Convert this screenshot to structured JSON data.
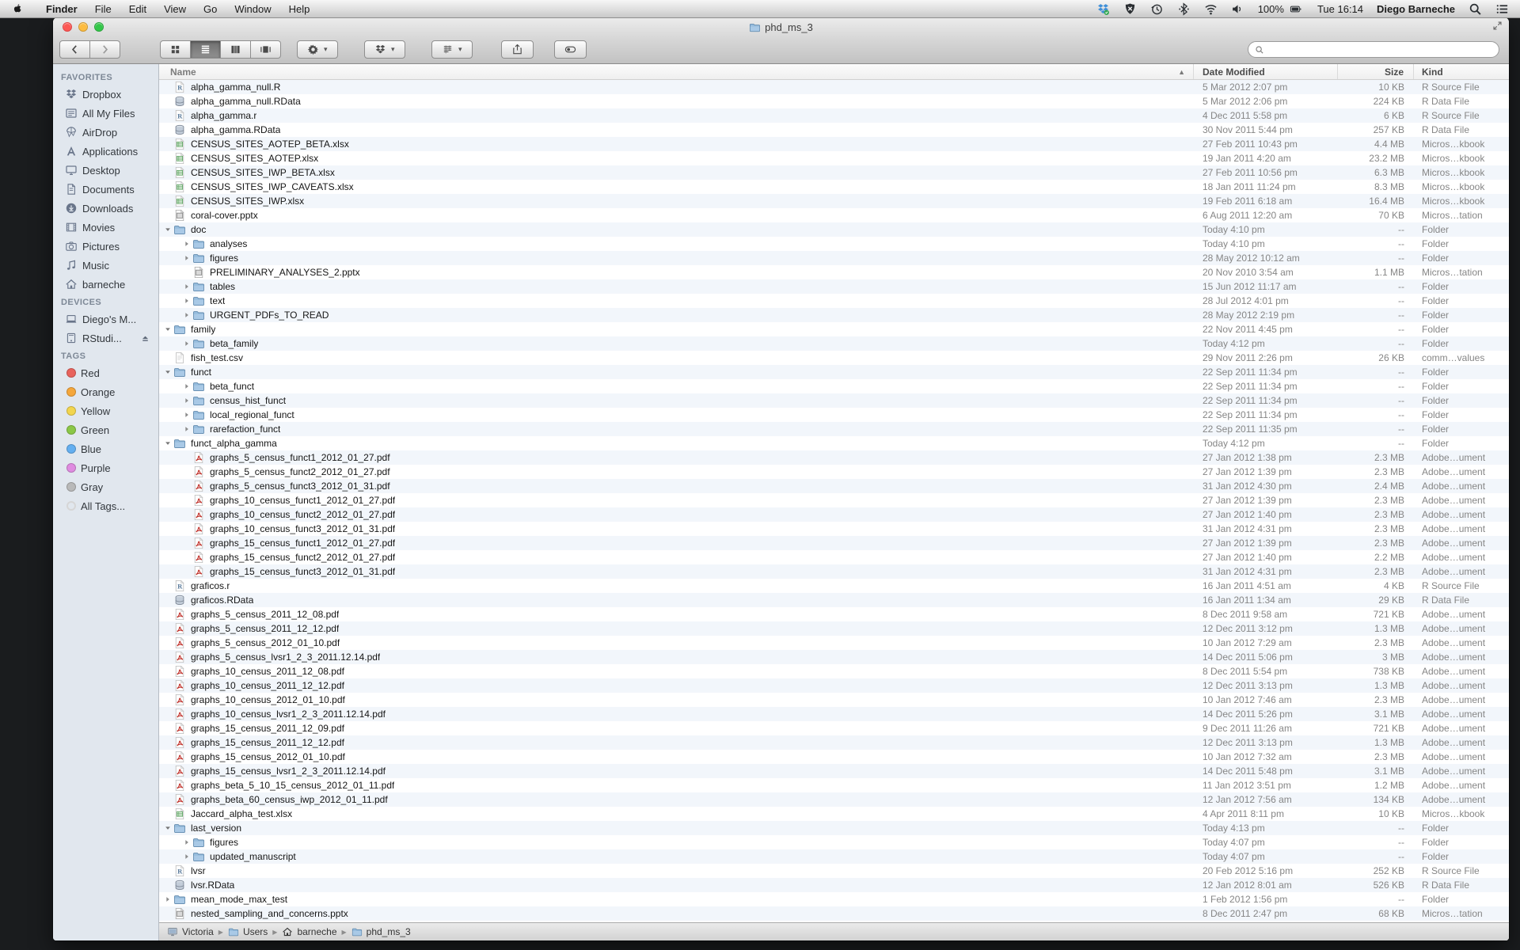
{
  "menu_bar": {
    "apple_icon": "apple",
    "items": [
      "Finder",
      "File",
      "Edit",
      "View",
      "Go",
      "Window",
      "Help"
    ],
    "active_app": "Finder",
    "status_icons": [
      "dropbox",
      "shield",
      "time-machine",
      "bluetooth",
      "wifi",
      "volume"
    ],
    "battery_percent": "100%",
    "clock": "Tue 16:14",
    "user": "Diego Barneche"
  },
  "window": {
    "title": "phd_ms_3",
    "title_icon": "folder",
    "traffic_lights": [
      "close",
      "minimize",
      "zoom"
    ]
  },
  "toolbar": {
    "nav": [
      "back",
      "forward"
    ],
    "view_modes": [
      "icons",
      "list",
      "columns",
      "coverflow"
    ],
    "selected_view": "list",
    "dropdowns": [
      "action-gear",
      "dropbox",
      "arrange"
    ],
    "buttons": [
      "share",
      "tags"
    ],
    "search": {
      "value": "",
      "placeholder": ""
    }
  },
  "sidebar": {
    "sections": [
      {
        "title": "FAVORITES",
        "items": [
          {
            "label": "Dropbox",
            "icon": "dropbox-side"
          },
          {
            "label": "All My Files",
            "icon": "all-my-files"
          },
          {
            "label": "AirDrop",
            "icon": "airdrop"
          },
          {
            "label": "Applications",
            "icon": "applications"
          },
          {
            "label": "Desktop",
            "icon": "desktop"
          },
          {
            "label": "Documents",
            "icon": "documents"
          },
          {
            "label": "Downloads",
            "icon": "downloads"
          },
          {
            "label": "Movies",
            "icon": "movies"
          },
          {
            "label": "Pictures",
            "icon": "pictures"
          },
          {
            "label": "Music",
            "icon": "music"
          },
          {
            "label": "barneche",
            "icon": "home"
          }
        ]
      },
      {
        "title": "DEVICES",
        "items": [
          {
            "label": "Diego's M...",
            "icon": "laptop"
          },
          {
            "label": "RStudi...",
            "icon": "drive",
            "eject": true
          }
        ]
      },
      {
        "title": "TAGS",
        "items": [
          {
            "label": "Red",
            "icon": "tag",
            "color": "#e8635c"
          },
          {
            "label": "Orange",
            "icon": "tag",
            "color": "#f5a73b"
          },
          {
            "label": "Yellow",
            "icon": "tag",
            "color": "#f2d54e"
          },
          {
            "label": "Green",
            "icon": "tag",
            "color": "#8bc747"
          },
          {
            "label": "Blue",
            "icon": "tag",
            "color": "#64aff0"
          },
          {
            "label": "Purple",
            "icon": "tag",
            "color": "#df8be0"
          },
          {
            "label": "Gray",
            "icon": "tag",
            "color": "#b9b9b9"
          },
          {
            "label": "All Tags...",
            "icon": "all-tags",
            "color": "#d6d6d6"
          }
        ]
      }
    ]
  },
  "list": {
    "columns": {
      "name": "Name",
      "date": "Date Modified",
      "size": "Size",
      "kind": "Kind"
    },
    "sort_column": "name",
    "sort_direction": "asc",
    "rows": [
      {
        "name": "alpha_gamma_null.R",
        "date": "5 Mar 2012 2:07 pm",
        "size": "10 KB",
        "kind": "R Source File",
        "icon": "r",
        "indent": 0,
        "disclosure": null
      },
      {
        "name": "alpha_gamma_null.RData",
        "date": "5 Mar 2012 2:06 pm",
        "size": "224 KB",
        "kind": "R Data File",
        "icon": "rdata",
        "indent": 0,
        "disclosure": null
      },
      {
        "name": "alpha_gamma.r",
        "date": "4 Dec 2011 5:58 pm",
        "size": "6 KB",
        "kind": "R Source File",
        "icon": "r",
        "indent": 0,
        "disclosure": null
      },
      {
        "name": "alpha_gamma.RData",
        "date": "30 Nov 2011 5:44 pm",
        "size": "257 KB",
        "kind": "R Data File",
        "icon": "rdata",
        "indent": 0,
        "disclosure": null
      },
      {
        "name": "CENSUS_SITES_AOTEP_BETA.xlsx",
        "date": "27 Feb 2011 10:43 pm",
        "size": "4.4 MB",
        "kind": "Micros…kbook",
        "icon": "xlsx",
        "indent": 0,
        "disclosure": null
      },
      {
        "name": "CENSUS_SITES_AOTEP.xlsx",
        "date": "19 Jan 2011 4:20 am",
        "size": "23.2 MB",
        "kind": "Micros…kbook",
        "icon": "xlsx",
        "indent": 0,
        "disclosure": null
      },
      {
        "name": "CENSUS_SITES_IWP_BETA.xlsx",
        "date": "27 Feb 2011 10:56 pm",
        "size": "6.3 MB",
        "kind": "Micros…kbook",
        "icon": "xlsx",
        "indent": 0,
        "disclosure": null
      },
      {
        "name": "CENSUS_SITES_IWP_CAVEATS.xlsx",
        "date": "18 Jan 2011 11:24 pm",
        "size": "8.3 MB",
        "kind": "Micros…kbook",
        "icon": "xlsx",
        "indent": 0,
        "disclosure": null
      },
      {
        "name": "CENSUS_SITES_IWP.xlsx",
        "date": "19 Feb 2011 6:18 am",
        "size": "16.4 MB",
        "kind": "Micros…kbook",
        "icon": "xlsx",
        "indent": 0,
        "disclosure": null
      },
      {
        "name": "coral-cover.pptx",
        "date": "6 Aug 2011 12:20 am",
        "size": "70 KB",
        "kind": "Micros…tation",
        "icon": "pptx",
        "indent": 0,
        "disclosure": null
      },
      {
        "name": "doc",
        "date": "Today 4:10 pm",
        "size": "--",
        "kind": "Folder",
        "icon": "folder",
        "indent": 0,
        "disclosure": "open"
      },
      {
        "name": "analyses",
        "date": "Today 4:10 pm",
        "size": "--",
        "kind": "Folder",
        "icon": "folder",
        "indent": 1,
        "disclosure": "closed"
      },
      {
        "name": "figures",
        "date": "28 May 2012 10:12 am",
        "size": "--",
        "kind": "Folder",
        "icon": "folder",
        "indent": 1,
        "disclosure": "closed"
      },
      {
        "name": "PRELIMINARY_ANALYSES_2.pptx",
        "date": "20 Nov 2010 3:54 am",
        "size": "1.1 MB",
        "kind": "Micros…tation",
        "icon": "pptx",
        "indent": 1,
        "disclosure": null
      },
      {
        "name": "tables",
        "date": "15 Jun 2012 11:17 am",
        "size": "--",
        "kind": "Folder",
        "icon": "folder",
        "indent": 1,
        "disclosure": "closed"
      },
      {
        "name": "text",
        "date": "28 Jul 2012 4:01 pm",
        "size": "--",
        "kind": "Folder",
        "icon": "folder",
        "indent": 1,
        "disclosure": "closed"
      },
      {
        "name": "URGENT_PDFs_TO_READ",
        "date": "28 May 2012 2:19 pm",
        "size": "--",
        "kind": "Folder",
        "icon": "folder",
        "indent": 1,
        "disclosure": "closed"
      },
      {
        "name": "family",
        "date": "22 Nov 2011 4:45 pm",
        "size": "--",
        "kind": "Folder",
        "icon": "folder",
        "indent": 0,
        "disclosure": "open"
      },
      {
        "name": "beta_family",
        "date": "Today 4:12 pm",
        "size": "--",
        "kind": "Folder",
        "icon": "folder",
        "indent": 1,
        "disclosure": "closed"
      },
      {
        "name": "fish_test.csv",
        "date": "29 Nov 2011 2:26 pm",
        "size": "26 KB",
        "kind": "comm…values",
        "icon": "csv",
        "indent": 0,
        "disclosure": null
      },
      {
        "name": "funct",
        "date": "22 Sep 2011 11:34 pm",
        "size": "--",
        "kind": "Folder",
        "icon": "folder",
        "indent": 0,
        "disclosure": "open"
      },
      {
        "name": "beta_funct",
        "date": "22 Sep 2011 11:34 pm",
        "size": "--",
        "kind": "Folder",
        "icon": "folder",
        "indent": 1,
        "disclosure": "closed"
      },
      {
        "name": "census_hist_funct",
        "date": "22 Sep 2011 11:34 pm",
        "size": "--",
        "kind": "Folder",
        "icon": "folder",
        "indent": 1,
        "disclosure": "closed"
      },
      {
        "name": "local_regional_funct",
        "date": "22 Sep 2011 11:34 pm",
        "size": "--",
        "kind": "Folder",
        "icon": "folder",
        "indent": 1,
        "disclosure": "closed"
      },
      {
        "name": "rarefaction_funct",
        "date": "22 Sep 2011 11:35 pm",
        "size": "--",
        "kind": "Folder",
        "icon": "folder",
        "indent": 1,
        "disclosure": "closed"
      },
      {
        "name": "funct_alpha_gamma",
        "date": "Today 4:12 pm",
        "size": "--",
        "kind": "Folder",
        "icon": "folder",
        "indent": 0,
        "disclosure": "open"
      },
      {
        "name": "graphs_5_census_funct1_2012_01_27.pdf",
        "date": "27 Jan 2012 1:38 pm",
        "size": "2.3 MB",
        "kind": "Adobe…ument",
        "icon": "pdf",
        "indent": 1,
        "disclosure": null
      },
      {
        "name": "graphs_5_census_funct2_2012_01_27.pdf",
        "date": "27 Jan 2012 1:39 pm",
        "size": "2.3 MB",
        "kind": "Adobe…ument",
        "icon": "pdf",
        "indent": 1,
        "disclosure": null
      },
      {
        "name": "graphs_5_census_funct3_2012_01_31.pdf",
        "date": "31 Jan 2012 4:30 pm",
        "size": "2.4 MB",
        "kind": "Adobe…ument",
        "icon": "pdf",
        "indent": 1,
        "disclosure": null
      },
      {
        "name": "graphs_10_census_funct1_2012_01_27.pdf",
        "date": "27 Jan 2012 1:39 pm",
        "size": "2.3 MB",
        "kind": "Adobe…ument",
        "icon": "pdf",
        "indent": 1,
        "disclosure": null
      },
      {
        "name": "graphs_10_census_funct2_2012_01_27.pdf",
        "date": "27 Jan 2012 1:40 pm",
        "size": "2.3 MB",
        "kind": "Adobe…ument",
        "icon": "pdf",
        "indent": 1,
        "disclosure": null
      },
      {
        "name": "graphs_10_census_funct3_2012_01_31.pdf",
        "date": "31 Jan 2012 4:31 pm",
        "size": "2.3 MB",
        "kind": "Adobe…ument",
        "icon": "pdf",
        "indent": 1,
        "disclosure": null
      },
      {
        "name": "graphs_15_census_funct1_2012_01_27.pdf",
        "date": "27 Jan 2012 1:39 pm",
        "size": "2.3 MB",
        "kind": "Adobe…ument",
        "icon": "pdf",
        "indent": 1,
        "disclosure": null
      },
      {
        "name": "graphs_15_census_funct2_2012_01_27.pdf",
        "date": "27 Jan 2012 1:40 pm",
        "size": "2.2 MB",
        "kind": "Adobe…ument",
        "icon": "pdf",
        "indent": 1,
        "disclosure": null
      },
      {
        "name": "graphs_15_census_funct3_2012_01_31.pdf",
        "date": "31 Jan 2012 4:31 pm",
        "size": "2.3 MB",
        "kind": "Adobe…ument",
        "icon": "pdf",
        "indent": 1,
        "disclosure": null
      },
      {
        "name": "graficos.r",
        "date": "16 Jan 2011 4:51 am",
        "size": "4 KB",
        "kind": "R Source File",
        "icon": "r",
        "indent": 0,
        "disclosure": null
      },
      {
        "name": "graficos.RData",
        "date": "16 Jan 2011 1:34 am",
        "size": "29 KB",
        "kind": "R Data File",
        "icon": "rdata",
        "indent": 0,
        "disclosure": null
      },
      {
        "name": "graphs_5_census_2011_12_08.pdf",
        "date": "8 Dec 2011 9:58 am",
        "size": "721 KB",
        "kind": "Adobe…ument",
        "icon": "pdf",
        "indent": 0,
        "disclosure": null
      },
      {
        "name": "graphs_5_census_2011_12_12.pdf",
        "date": "12 Dec 2011 3:12 pm",
        "size": "1.3 MB",
        "kind": "Adobe…ument",
        "icon": "pdf",
        "indent": 0,
        "disclosure": null
      },
      {
        "name": "graphs_5_census_2012_01_10.pdf",
        "date": "10 Jan 2012 7:29 am",
        "size": "2.3 MB",
        "kind": "Adobe…ument",
        "icon": "pdf",
        "indent": 0,
        "disclosure": null
      },
      {
        "name": "graphs_5_census_lvsr1_2_3_2011.12.14.pdf",
        "date": "14 Dec 2011 5:06 pm",
        "size": "3 MB",
        "kind": "Adobe…ument",
        "icon": "pdf",
        "indent": 0,
        "disclosure": null
      },
      {
        "name": "graphs_10_census_2011_12_08.pdf",
        "date": "8 Dec 2011 5:54 pm",
        "size": "738 KB",
        "kind": "Adobe…ument",
        "icon": "pdf",
        "indent": 0,
        "disclosure": null
      },
      {
        "name": "graphs_10_census_2011_12_12.pdf",
        "date": "12 Dec 2011 3:13 pm",
        "size": "1.3 MB",
        "kind": "Adobe…ument",
        "icon": "pdf",
        "indent": 0,
        "disclosure": null
      },
      {
        "name": "graphs_10_census_2012_01_10.pdf",
        "date": "10 Jan 2012 7:46 am",
        "size": "2.3 MB",
        "kind": "Adobe…ument",
        "icon": "pdf",
        "indent": 0,
        "disclosure": null
      },
      {
        "name": "graphs_10_census_lvsr1_2_3_2011.12.14.pdf",
        "date": "14 Dec 2011 5:26 pm",
        "size": "3.1 MB",
        "kind": "Adobe…ument",
        "icon": "pdf",
        "indent": 0,
        "disclosure": null
      },
      {
        "name": "graphs_15_census_2011_12_09.pdf",
        "date": "9 Dec 2011 11:26 am",
        "size": "721 KB",
        "kind": "Adobe…ument",
        "icon": "pdf",
        "indent": 0,
        "disclosure": null
      },
      {
        "name": "graphs_15_census_2011_12_12.pdf",
        "date": "12 Dec 2011 3:13 pm",
        "size": "1.3 MB",
        "kind": "Adobe…ument",
        "icon": "pdf",
        "indent": 0,
        "disclosure": null
      },
      {
        "name": "graphs_15_census_2012_01_10.pdf",
        "date": "10 Jan 2012 7:32 am",
        "size": "2.3 MB",
        "kind": "Adobe…ument",
        "icon": "pdf",
        "indent": 0,
        "disclosure": null
      },
      {
        "name": "graphs_15_census_lvsr1_2_3_2011.12.14.pdf",
        "date": "14 Dec 2011 5:48 pm",
        "size": "3.1 MB",
        "kind": "Adobe…ument",
        "icon": "pdf",
        "indent": 0,
        "disclosure": null
      },
      {
        "name": "graphs_beta_5_10_15_census_2012_01_11.pdf",
        "date": "11 Jan 2012 3:51 pm",
        "size": "1.2 MB",
        "kind": "Adobe…ument",
        "icon": "pdf",
        "indent": 0,
        "disclosure": null
      },
      {
        "name": "graphs_beta_60_census_iwp_2012_01_11.pdf",
        "date": "12 Jan 2012 7:56 am",
        "size": "134 KB",
        "kind": "Adobe…ument",
        "icon": "pdf",
        "indent": 0,
        "disclosure": null
      },
      {
        "name": "Jaccard_alpha_test.xlsx",
        "date": "4 Apr 2011 8:11 pm",
        "size": "10 KB",
        "kind": "Micros…kbook",
        "icon": "xlsx",
        "indent": 0,
        "disclosure": null
      },
      {
        "name": "last_version",
        "date": "Today 4:13 pm",
        "size": "--",
        "kind": "Folder",
        "icon": "folder",
        "indent": 0,
        "disclosure": "open"
      },
      {
        "name": "figures",
        "date": "Today 4:07 pm",
        "size": "--",
        "kind": "Folder",
        "icon": "folder",
        "indent": 1,
        "disclosure": "closed"
      },
      {
        "name": "updated_manuscript",
        "date": "Today 4:07 pm",
        "size": "--",
        "kind": "Folder",
        "icon": "folder",
        "indent": 1,
        "disclosure": "closed"
      },
      {
        "name": "lvsr",
        "date": "20 Feb 2012 5:16 pm",
        "size": "252 KB",
        "kind": "R Source File",
        "icon": "r",
        "indent": 0,
        "disclosure": null
      },
      {
        "name": "lvsr.RData",
        "date": "12 Jan 2012 8:01 am",
        "size": "526 KB",
        "kind": "R Data File",
        "icon": "rdata",
        "indent": 0,
        "disclosure": null
      },
      {
        "name": "mean_mode_max_test",
        "date": "1 Feb 2012 1:56 pm",
        "size": "--",
        "kind": "Folder",
        "icon": "folder",
        "indent": 0,
        "disclosure": "closed"
      },
      {
        "name": "nested_sampling_and_concerns.pptx",
        "date": "8 Dec 2011 2:47 pm",
        "size": "68 KB",
        "kind": "Micros…tation",
        "icon": "pptx",
        "indent": 0,
        "disclosure": null
      }
    ]
  },
  "path_bar": [
    {
      "label": "Victoria",
      "icon": "computer"
    },
    {
      "label": "Users",
      "icon": "folder"
    },
    {
      "label": "barneche",
      "icon": "home"
    },
    {
      "label": "phd_ms_3",
      "icon": "folder"
    }
  ]
}
